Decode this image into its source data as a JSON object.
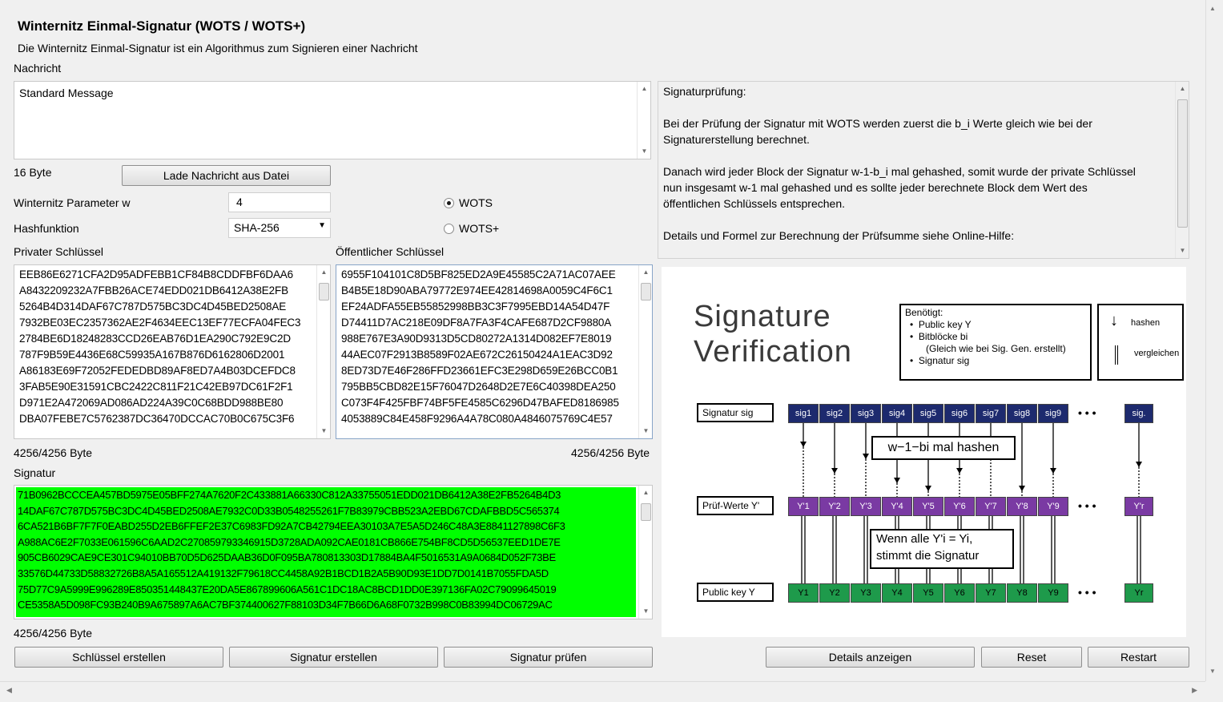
{
  "title": "Winternitz Einmal-Signatur (WOTS / WOTS+)",
  "subtitle": "Die Winternitz Einmal-Signatur ist ein Algorithmus zum Signieren einer Nachricht",
  "message": {
    "label": "Nachricht",
    "value": "Standard Message",
    "size": "16 Byte",
    "load_button": "Lade Nachricht aus Datei"
  },
  "params": {
    "w_label": "Winternitz Parameter w",
    "w_value": "4",
    "hash_label": "Hashfunktion",
    "hash_value": "SHA-256",
    "radio_wots": "WOTS",
    "radio_wotsplus": "WOTS+",
    "selected": "WOTS"
  },
  "private_key": {
    "label": "Privater Schlüssel",
    "lines": [
      "EEB86E6271CFA2D95ADFEBB1CF84B8CDDFBF6DAA6",
      "A8432209232A7FBB26ACE74EDD021DB6412A38E2FB",
      "5264B4D314DAF67C787D575BC3DC4D45BED2508AE",
      "7932BE03EC2357362AE2F4634EEC13EF77ECFA04FEC3",
      "2784BE6D18248283CCD26EAB76D1EA290C792E9C2D",
      "787F9B59E4436E68C59935A167B876D6162806D2001",
      "A86183E69F72052FEDEDBD89AF8ED7A4B03DCEFDC8",
      "3FAB5E90E31591CBC2422C811F21C42EB97DC61F2F1",
      "D971E2A472069AD086AD224A39C0C68BDD988BE80",
      "DBA07FEBE7C5762387DC36470DCCAC70B0C675C3F6"
    ],
    "size": "4256/4256 Byte"
  },
  "public_key": {
    "label": "Öffentlicher Schlüssel",
    "lines": [
      "6955F104101C8D5BF825ED2A9E45585C2A71AC07AEE",
      "B4B5E18D90ABA79772E974EE42814698A0059C4F6C1",
      "EF24ADFA55EB55852998BB3C3F7995EBD14A54D47F",
      "D74411D7AC218E09DF8A7FA3F4CAFE687D2CF9880A",
      "988E767E3A90D9313D5CD80272A1314D082EF7E8019",
      "44AEC07F2913B8589F02AE672C26150424A1EAC3D92",
      "8ED73D7E46F286FFD23661EFC3E298D659E26BCC0B1",
      "795BB5CBD82E15F76047D2648D2E7E6C40398DEA250",
      "C073F4F425FBF74BF5FE4585C6296D47BAFED8186985",
      "4053889C84E458F9296A4A78C080A4846075769C4E57"
    ],
    "size": "4256/4256 Byte"
  },
  "signature": {
    "label": "Signatur",
    "lines": [
      "71B0962BCCCEA457BD5975E05BFF274A7620F2C433881A66330C812A33755051EDD021DB6412A38E2FB5264B4D3",
      "14DAF67C787D575BC3DC4D45BED2508AE7932C0D33B0548255261F7B83979CBB523A2EBD67CDAFBBD5C565374",
      "6CA521B6BF7F7F0EABD255D2EB6FFEF2E37C6983FD92A7CB42794EEA30103A7E5A5D246C48A3E8841127898C6F3",
      "A988AC6E2F7033E061596C6AAD2C270859793346915D3728ADA092CAE0181CB866E754BF8CD5D56537EED1DE7E",
      "905CB6029CAE9CE301C94010BB70D5D625DAAB36D0F095BA780813303D17884BA4F5016531A9A0684D052F73BE",
      "33576D44733D58832726B8A5A165512A419132F79618CC4458A92B1BCD1B2A5B90D93E1DD7D0141B7055FDA5D",
      "75D77C9A5999E996289E850351448437E20DA5E867899606A561C1DC18AC8BCD1DD0E397136FA02C79099645019",
      "CE5358A5D098FC93B240B9A675897A6AC7BF374400627F88103D34F7B66D6A68F0732B998C0B83994DC06729AC"
    ],
    "size": "4256/4256 Byte"
  },
  "info": {
    "lines": [
      "Signaturprüfung:",
      "",
      "Bei der Prüfung der Signatur mit WOTS werden zuerst die b_i Werte gleich wie bei der",
      "Signaturerstellung berechnet.",
      "",
      "Danach wird jeder Block der Signatur w-1-b_i mal gehashed, somit wurde der private Schlüssel",
      "nun insgesamt w-1 mal gehashed und es sollte jeder berechnete Block dem Wert des",
      "öffentlichen Schlüssels entsprechen.",
      "",
      "Details und Formel zur Berechnung der Prüfsumme siehe Online-Hilfe:"
    ]
  },
  "diagram": {
    "title_line1": "Signature",
    "title_line2": "Verification",
    "needed_title": "Benötigt:",
    "needed_items": [
      "Public key Y",
      "Bitblöcke bi",
      "(Gleich wie bei Sig. Gen. erstellt)",
      "Signatur sig"
    ],
    "legend_hash": "hashen",
    "legend_compare": "vergleichen",
    "row_sig_label": "Signatur sig",
    "row_check_label": "Prüf-Werte Y'",
    "row_pub_label": "Public key Y",
    "sig_cells": [
      "sig1",
      "sig2",
      "sig3",
      "sig4",
      "sig5",
      "sig6",
      "sig7",
      "sig8",
      "sig9"
    ],
    "sig_last": "sig.",
    "check_cells": [
      "Y'1",
      "Y'2",
      "Y'3",
      "Y'4",
      "Y'5",
      "Y'6",
      "Y'7",
      "Y'8",
      "Y'9"
    ],
    "check_last": "Y'r",
    "pub_cells": [
      "Y1",
      "Y2",
      "Y3",
      "Y4",
      "Y5",
      "Y6",
      "Y7",
      "Y8",
      "Y9"
    ],
    "pub_last": "Yr",
    "dots": "• • •",
    "hash_note": "w−1−bi mal hashen",
    "compare_note_1": "Wenn alle Y'i = Yi,",
    "compare_note_2": "stimmt die Signatur"
  },
  "buttons": {
    "create_keys": "Schlüssel erstellen",
    "create_sig": "Signatur erstellen",
    "verify_sig": "Signatur prüfen",
    "details": "Details anzeigen",
    "reset": "Reset",
    "restart": "Restart"
  },
  "colors": {
    "signature_bg": "#00ff00",
    "sig_blue": "#1d2a6e",
    "check_purple": "#7a3aa3",
    "pub_green": "#1e9a4b"
  }
}
